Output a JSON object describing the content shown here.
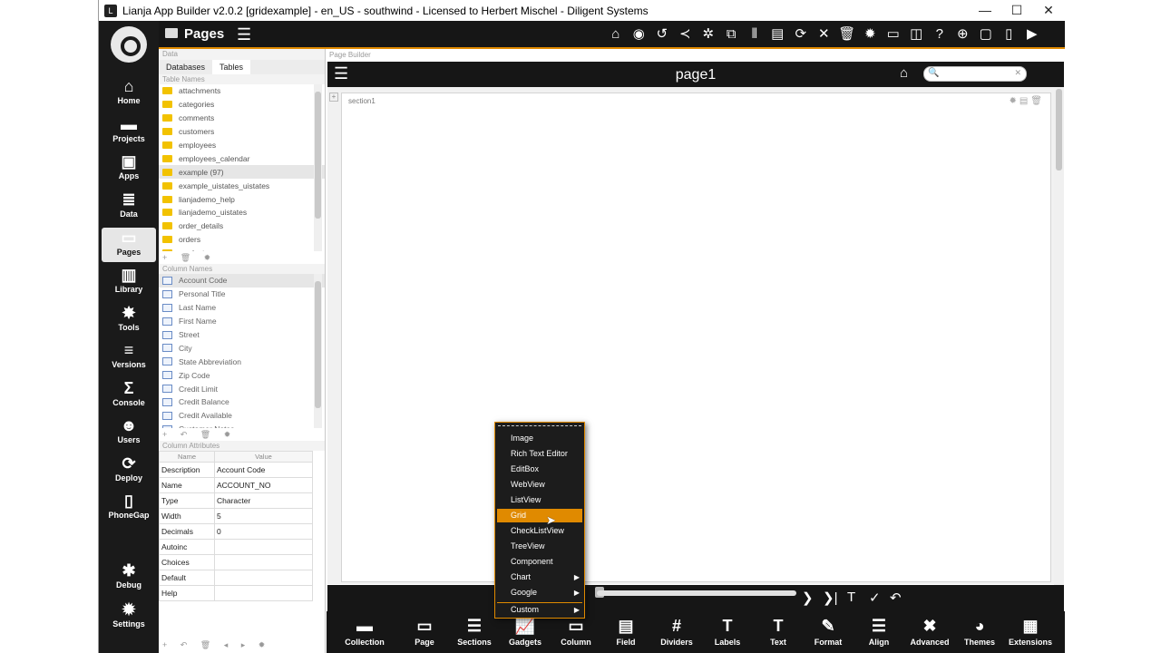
{
  "titlebar": {
    "title": "Lianja App Builder v2.0.2 [gridexample] - en_US - southwind - Licensed to Herbert Mischel - Diligent Systems",
    "minimize": "—",
    "maximize": "☐",
    "close": "✕"
  },
  "nav": [
    {
      "label": "Home",
      "icon": "home-icon",
      "glyph": "⌂"
    },
    {
      "label": "Projects",
      "icon": "folder-icon",
      "glyph": "▬"
    },
    {
      "label": "Apps",
      "icon": "apps-icon",
      "glyph": "▣"
    },
    {
      "label": "Data",
      "icon": "database-icon",
      "glyph": "≣"
    },
    {
      "label": "Pages",
      "icon": "pages-icon",
      "glyph": "▭"
    },
    {
      "label": "Library",
      "icon": "library-icon",
      "glyph": "▥"
    },
    {
      "label": "Tools",
      "icon": "gear-icon",
      "glyph": "✸"
    },
    {
      "label": "Versions",
      "icon": "versions-icon",
      "glyph": "≡"
    },
    {
      "label": "Console",
      "icon": "console-icon",
      "glyph": "Σ"
    },
    {
      "label": "Users",
      "icon": "users-icon",
      "glyph": "☻"
    },
    {
      "label": "Deploy",
      "icon": "deploy-icon",
      "glyph": "⟳"
    },
    {
      "label": "PhoneGap",
      "icon": "phone-icon",
      "glyph": "▯"
    },
    {
      "label": "Debug",
      "icon": "debug-icon",
      "glyph": "✱"
    },
    {
      "label": "Settings",
      "icon": "settings-icon",
      "glyph": "✹"
    }
  ],
  "toolbar": {
    "title": "Pages",
    "icons": [
      "⌂",
      "◉",
      "↺",
      "≺",
      "✲",
      "⧉",
      "⦀",
      "▤",
      "⟳",
      "✕",
      "🗑",
      "✹",
      "▭",
      "◫",
      "?",
      "⊕",
      "▢",
      "▯",
      "▶"
    ]
  },
  "data_panel": {
    "header": "Data",
    "tabs": [
      "Databases",
      "Tables"
    ],
    "table_names_header": "Table Names",
    "tables": [
      "attachments",
      "categories",
      "comments",
      "customers",
      "employees",
      "employees_calendar",
      "example (97)",
      "example_uistates_uistates",
      "lianjademo_help",
      "lianjademo_uistates",
      "order_details",
      "orders",
      "products"
    ],
    "selected_table": "example (97)",
    "column_names_header": "Column Names",
    "columns": [
      "Account Code",
      "Personal Title",
      "Last Name",
      "First Name",
      "Street",
      "City",
      "State Abbreviation",
      "Zip Code",
      "Credit Limit",
      "Credit Balance",
      "Credit Available",
      "Customer Notes"
    ],
    "column_attributes_header": "Column Attributes",
    "attr_name_header": "Name",
    "attr_value_header": "Value",
    "attributes": [
      {
        "name": "Description",
        "value": "Account Code"
      },
      {
        "name": "Name",
        "value": "ACCOUNT_NO"
      },
      {
        "name": "Type",
        "value": "Character"
      },
      {
        "name": "Width",
        "value": "5"
      },
      {
        "name": "Decimals",
        "value": "0"
      },
      {
        "name": "Autoinc",
        "value": ""
      },
      {
        "name": "Choices",
        "value": ""
      },
      {
        "name": "Default",
        "value": ""
      },
      {
        "name": "Help",
        "value": ""
      }
    ]
  },
  "builder": {
    "header": "Page Builder",
    "page_title": "page1",
    "section_title": "section1"
  },
  "context_menu": {
    "items": [
      "Image",
      "Rich Text Editor",
      "EditBox",
      "WebView",
      "ListView",
      "Grid",
      "CheckListView",
      "TreeView",
      "Component",
      "Chart",
      "Google",
      "Custom"
    ],
    "highlighted": "Grid",
    "submenus": [
      "Chart",
      "Google",
      "Custom"
    ]
  },
  "bottom_bar": [
    "Collection",
    "Page",
    "Sections",
    "Gadgets",
    "Column",
    "Field",
    "Dividers",
    "Labels",
    "Text",
    "Format",
    "Align",
    "Advanced",
    "Themes",
    "Extensions"
  ],
  "bottom_icons": [
    "▬",
    "▭",
    "☰",
    "📈",
    "▭",
    "▤",
    "#",
    "T",
    "T",
    "✎",
    "☰",
    "✖",
    "◕",
    "▦"
  ],
  "colors": {
    "accent": "#e08a00",
    "dark": "#161616"
  }
}
